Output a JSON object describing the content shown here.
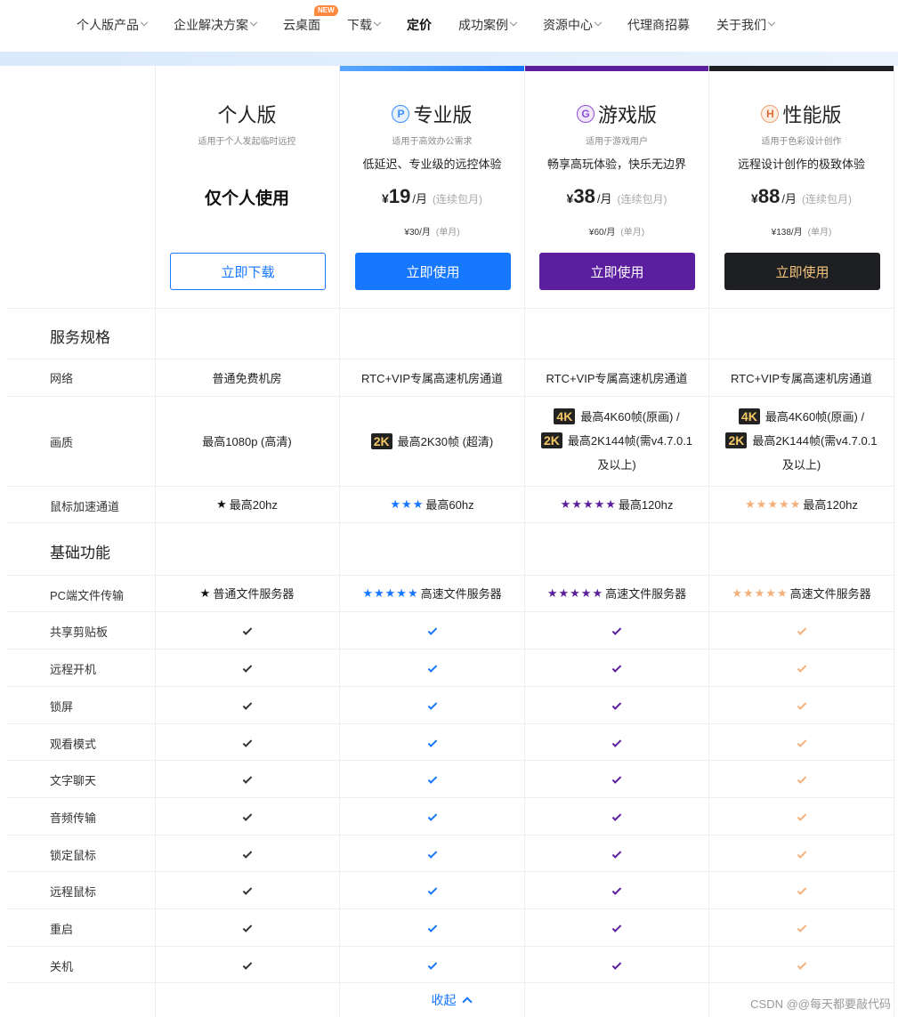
{
  "nav": {
    "items": [
      {
        "label": "个人版产品",
        "chevron": true
      },
      {
        "label": "企业解决方案",
        "chevron": true
      },
      {
        "label": "云桌面",
        "chevron": false,
        "badge": "NEW"
      },
      {
        "label": "下载",
        "chevron": true
      },
      {
        "label": "定价",
        "chevron": false,
        "active": true
      },
      {
        "label": "成功案例",
        "chevron": true
      },
      {
        "label": "资源中心",
        "chevron": true
      },
      {
        "label": "代理商招募",
        "chevron": false
      },
      {
        "label": "关于我们",
        "chevron": true
      }
    ]
  },
  "plans": [
    {
      "name": "个人版",
      "icon": "",
      "subtitle": "适用于个人发起临时远控",
      "only_text": "仅个人使用",
      "button": "立即下载",
      "color": "#1677ff",
      "button_style": "outline"
    },
    {
      "name": "专业版",
      "icon": "P",
      "subtitle": "适用于高效办公需求",
      "desc": "低延迟、专业级的远控体验",
      "price": "19",
      "unit": "/月",
      "note": "(连续包月)",
      "single": "¥30/月",
      "single_note": "(单月)",
      "button": "立即使用",
      "color": "#1677ff",
      "top_color": "#2f8cff"
    },
    {
      "name": "游戏版",
      "icon": "G",
      "subtitle": "适用于游戏用户",
      "desc": "畅享高玩体验，快乐无边界",
      "price": "38",
      "unit": "/月",
      "note": "(连续包月)",
      "single": "¥60/月",
      "single_note": "(单月)",
      "button": "立即使用",
      "color": "#5b1e9e",
      "top_color": "#5b1e9e"
    },
    {
      "name": "性能版",
      "icon": "H",
      "subtitle": "适用于色彩设计创作",
      "desc": "远程设计创作的极致体验",
      "price": "88",
      "unit": "/月",
      "note": "(连续包月)",
      "single": "¥138/月",
      "single_note": "(单月)",
      "button": "立即使用",
      "color": "#1e1f23",
      "top_color": "#1e1f23"
    }
  ],
  "sections": {
    "spec": "服务规格",
    "basic": "基础功能"
  },
  "spec_rows": {
    "network": {
      "label": "网络",
      "values": [
        "普通免费机房",
        "RTC+VIP专属高速机房通道",
        "RTC+VIP专属高速机房通道",
        "RTC+VIP专属高速机房通道"
      ]
    },
    "quality": {
      "label": "画质",
      "personal": "最高1080p (高清)",
      "pro_badge": "2K",
      "pro": "最高2K30帧 (超清)",
      "game_line1_badge": "4K",
      "game_line1": "最高4K60帧(原画) /",
      "game_line2_badge": "2K",
      "game_line2": "最高2K144帧(需v4.7.0.1",
      "game_line3": "及以上)",
      "perf_line1_badge": "4K",
      "perf_line1": "最高4K60帧(原画) /",
      "perf_line2_badge": "2K",
      "perf_line2": "最高2K144帧(需v4.7.0.1",
      "perf_line3": "及以上)"
    },
    "mouse": {
      "label": "鼠标加速通道",
      "values": [
        {
          "stars": "★",
          "text": "最高20hz",
          "color": "#111"
        },
        {
          "stars": "★★★",
          "text": "最高60hz",
          "color": "#1677ff"
        },
        {
          "stars": "★★★★★",
          "text": "最高120hz",
          "color": "#5b1e9e"
        },
        {
          "stars": "★★★★★",
          "text": "最高120hz",
          "color": "#f5b07a"
        }
      ]
    }
  },
  "file_row": {
    "label": "PC端文件传输",
    "values": [
      {
        "stars": "★",
        "text": "普通文件服务器",
        "color": "#111"
      },
      {
        "stars": "★★★★★",
        "text": "高速文件服务器",
        "color": "#1677ff"
      },
      {
        "stars": "★★★★★",
        "text": "高速文件服务器",
        "color": "#5b1e9e"
      },
      {
        "stars": "★★★★★",
        "text": "高速文件服务器",
        "color": "#f5b07a"
      }
    ]
  },
  "feature_rows": [
    "共享剪贴板",
    "远程开机",
    "锁屏",
    "观看模式",
    "文字聊天",
    "音频传输",
    "锁定鼠标",
    "远程鼠标",
    "重启",
    "关机"
  ],
  "check_colors": [
    "#333333",
    "#1677ff",
    "#5b1e9e",
    "#f5b07a"
  ],
  "collapse_label": "收起",
  "watermark": "CSDN @@每天都要敲代码"
}
